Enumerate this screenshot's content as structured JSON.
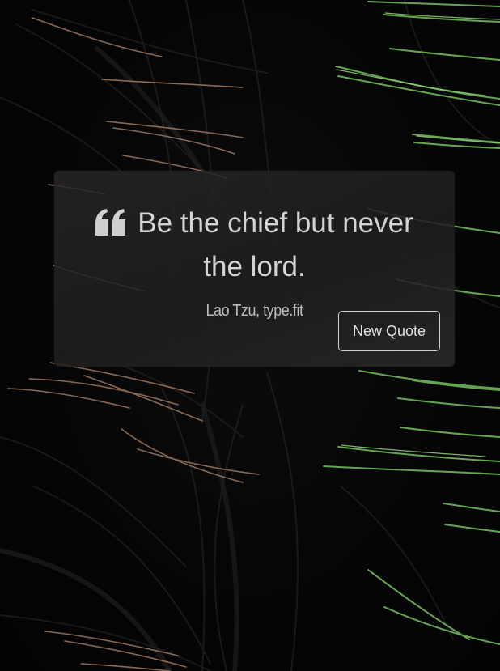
{
  "quote": {
    "text": "Be the chief but never the lord.",
    "author": "Lao Tzu, type.fit",
    "icon": "quote-left-icon"
  },
  "actions": {
    "new_quote_label": "New Quote"
  },
  "colors": {
    "background": "#050505",
    "card": "#262626",
    "text": "#d4d4d4",
    "strand_green": "#8fd96f",
    "strand_copper": "#c89a7a"
  }
}
